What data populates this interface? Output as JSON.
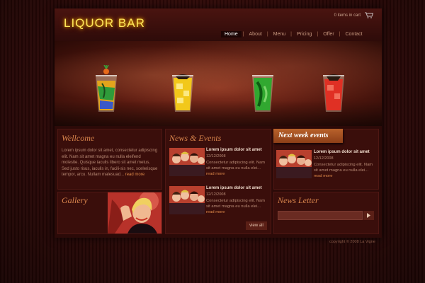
{
  "header": {
    "logo": "LIQUOR BAR",
    "cart_text": "0 items in cart",
    "nav": [
      {
        "label": "Home",
        "active": true
      },
      {
        "label": "About"
      },
      {
        "label": "Menu"
      },
      {
        "label": "Pricing"
      },
      {
        "label": "Offer"
      },
      {
        "label": "Contact"
      }
    ],
    "nav_separator": "|"
  },
  "hero": {
    "glasses": [
      {
        "icon": "cocktail-rainbow-icon",
        "color": "#e3a41c"
      },
      {
        "icon": "cocktail-yellow-icon",
        "color": "#f2c81a"
      },
      {
        "icon": "cocktail-green-icon",
        "color": "#31a830"
      },
      {
        "icon": "cocktail-red-icon",
        "color": "#e03024"
      }
    ]
  },
  "welcome": {
    "title": "Wellcome",
    "text": "Lorem ipsum dolor sit amet, consectetur adipiscing elit. Nam sit amet magna eu nulla eleifend molestie. Quisque iaculis libero sit amet metus. Sed justo risus, iaculis in, facili-sis nec, scelerisque tempor, arcu. Nullam malesuad...",
    "read_more": "read more"
  },
  "gallery": {
    "title": "Gallery"
  },
  "news": {
    "title": "News & Events",
    "items": [
      {
        "heading": "Lorem ipsum dolor sit amet",
        "date": "12/12/2008",
        "body": "Consectetur adipiscing elit. Nam sit amet magna eu nulla elei...",
        "read_more": "read more"
      },
      {
        "heading": "Lorem ipsum dolor sit amet",
        "date": "12/12/2008",
        "body": "Consectetur adipiscing elit. Nam sit amet magna eu nulla elei...",
        "read_more": "read more"
      }
    ],
    "view_all": "view all"
  },
  "next_week": {
    "title": "Next week events",
    "item": {
      "heading": "Lorem ipsum dolor sit amet",
      "date": "12/12/2008",
      "body": "Consectetur adipiscing elit. Nam sit amet magna eu nulla elei...",
      "read_more": "read more"
    }
  },
  "newsletter": {
    "title": "News Letter",
    "input_value": ""
  },
  "footer": {
    "copyright": "copyright © 2008 La Vigne"
  },
  "colors": {
    "accent": "#d8844c",
    "logo_glow": "#ffe85a",
    "background": "#2a0807"
  }
}
